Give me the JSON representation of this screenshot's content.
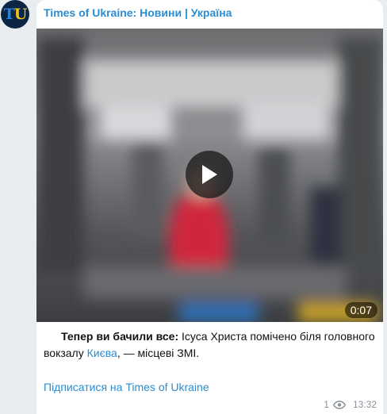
{
  "channel": {
    "name": "Times of Ukraine: Новини | Україна",
    "avatar_letters": {
      "first": "T",
      "second": "U"
    }
  },
  "video": {
    "duration": "0:07"
  },
  "post": {
    "bold_lead": "Тепер ви бачили все:",
    "text_part1": " Ісуса Христа помічено біля головного вокзалу ",
    "link_text": "Києва",
    "text_part2": ", — місцеві ЗМІ.",
    "subscribe_link": "Підписатися на Times of Ukraine"
  },
  "meta": {
    "views": "1",
    "time": "13:32",
    "icon": "eye-icon"
  },
  "colors": {
    "link": "#2b8dd2",
    "background": "#e9edf0",
    "bubble": "#ffffff"
  }
}
